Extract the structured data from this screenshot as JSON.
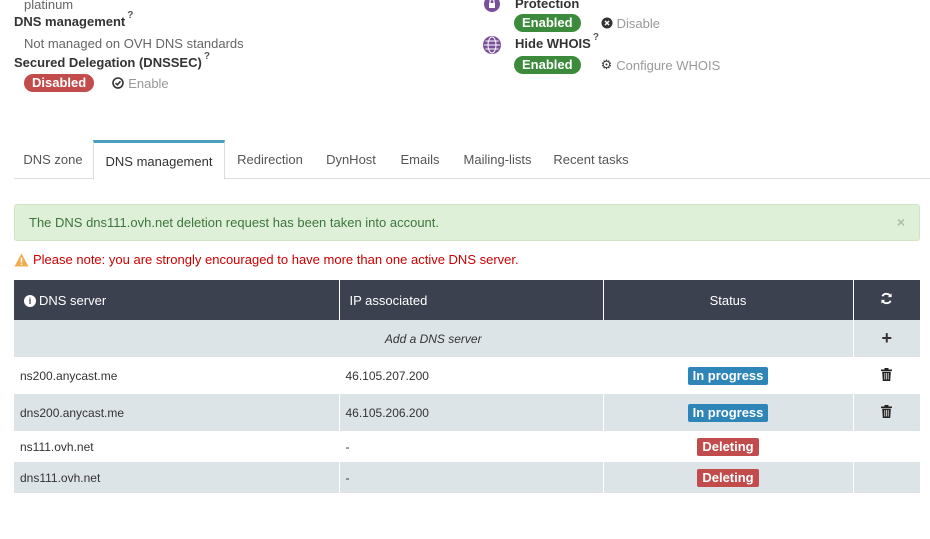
{
  "info": {
    "offer_value": "platinum",
    "dns_management_label": "DNS management",
    "dns_management_help": "?",
    "dns_management_value": "Not managed on OVH DNS standards",
    "secured_delegation_label": "Secured Delegation (DNSSEC)",
    "secured_delegation_help": "?",
    "secured_delegation_status": "Disabled",
    "secured_delegation_action": "Enable",
    "protection_label": "Protection",
    "protection_help": "?",
    "protection_status": "Enabled",
    "protection_action": "Disable",
    "hide_whois_label": "Hide WHOIS",
    "hide_whois_help": "?",
    "hide_whois_status": "Enabled",
    "hide_whois_action": "Configure WHOIS"
  },
  "tabs": [
    {
      "label": "DNS zone"
    },
    {
      "label": "DNS management"
    },
    {
      "label": "Redirection"
    },
    {
      "label": "DynHost"
    },
    {
      "label": "Emails"
    },
    {
      "label": "Mailing-lists"
    },
    {
      "label": "Recent tasks"
    }
  ],
  "alert": {
    "message": "The DNS dns111.ovh.net deletion request has been taken into account.",
    "close": "×"
  },
  "warning": "Please note: you are strongly encouraged to have more than one active DNS server.",
  "table": {
    "headers": {
      "dns_server": "DNS server",
      "ip": "IP associated",
      "status": "Status"
    },
    "add_label": "Add a DNS server",
    "add_icon": "+",
    "rows": [
      {
        "server": "ns200.anycast.me",
        "ip": "46.105.207.200",
        "status": "In progress"
      },
      {
        "server": "dns200.anycast.me",
        "ip": "46.105.206.200",
        "status": "In progress"
      },
      {
        "server": "ns111.ovh.net",
        "ip": "-",
        "status": "Deleting"
      },
      {
        "server": "dns111.ovh.net",
        "ip": "-",
        "status": "Deleting"
      }
    ]
  },
  "colors": {
    "enabled": "#3c8b3c",
    "disabled": "#c24b4b",
    "in_progress": "#2e86b8",
    "deleting": "#c24b4b",
    "table_header": "#3b414f",
    "tab_accent": "#4a9fbc"
  }
}
